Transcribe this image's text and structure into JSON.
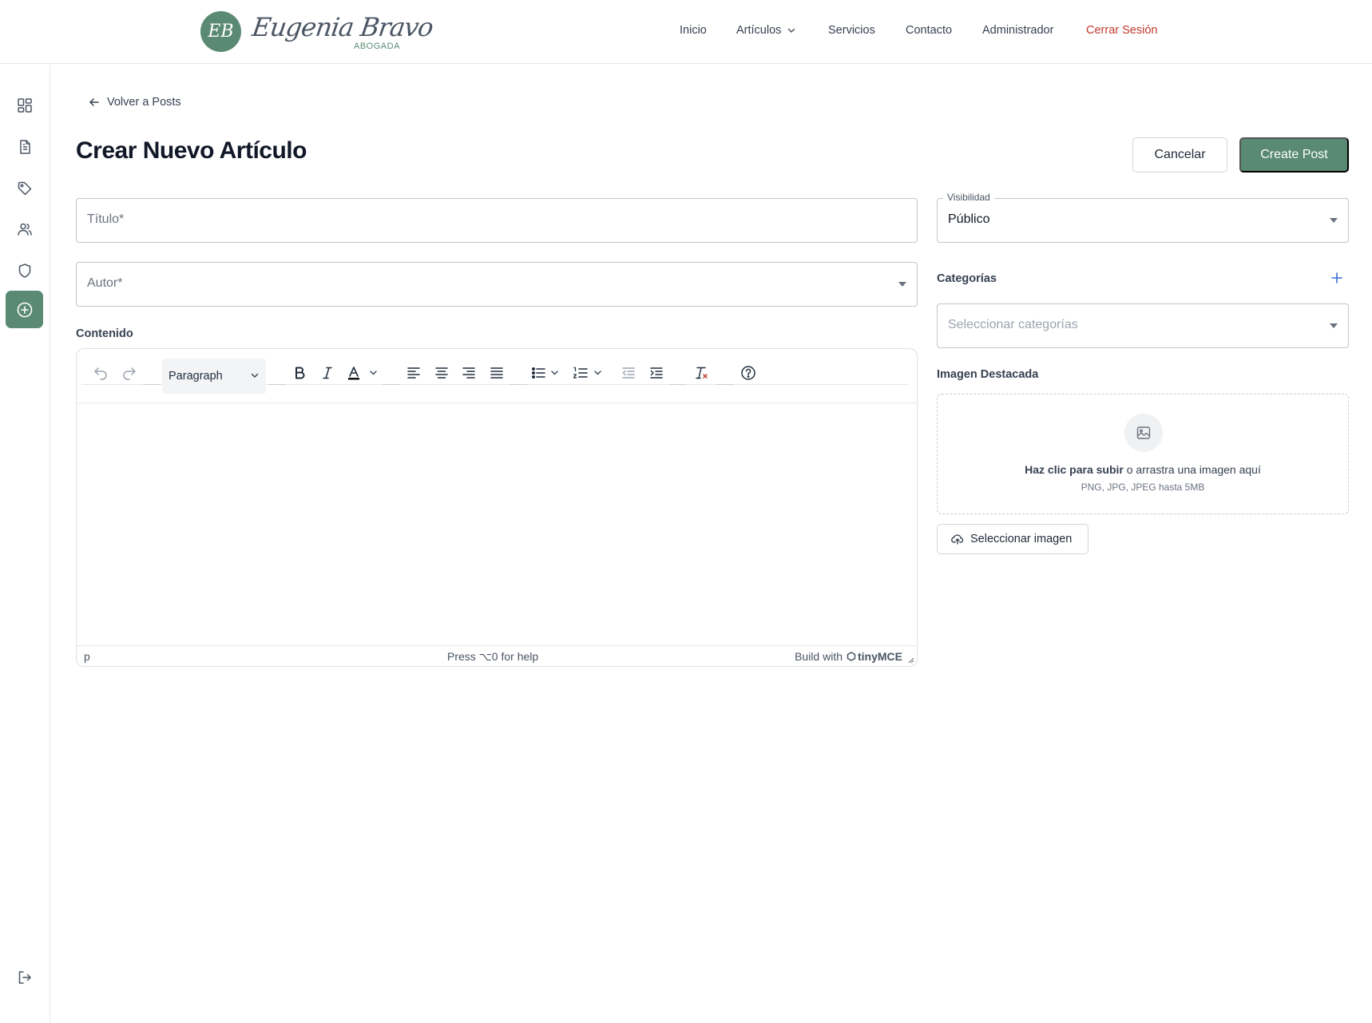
{
  "brand": {
    "monogram": "EB",
    "name": "Eugenia Bravo",
    "subtitle": "ABOGADA",
    "accent": "#5a8a73"
  },
  "nav": {
    "items": [
      {
        "label": "Inicio"
      },
      {
        "label": "Artículos",
        "has_dropdown": true
      },
      {
        "label": "Servicios"
      },
      {
        "label": "Contacto"
      },
      {
        "label": "Administrador"
      },
      {
        "label": "Cerrar Sesión",
        "color": "#c0392b"
      }
    ]
  },
  "sidebar": {
    "items": [
      {
        "icon": "dashboard-icon"
      },
      {
        "icon": "document-icon"
      },
      {
        "icon": "tag-icon"
      },
      {
        "icon": "users-icon"
      },
      {
        "icon": "shield-icon"
      },
      {
        "icon": "plus-circle-icon",
        "active": true
      }
    ],
    "bottom_icon": "logout-icon"
  },
  "page": {
    "back_label": "Volver a Posts",
    "title": "Crear Nuevo Artículo",
    "cancel_label": "Cancelar",
    "create_label": "Create Post"
  },
  "form": {
    "title_label": "Título",
    "title_value": "",
    "author_label": "Autor",
    "author_value": "",
    "required_mark": "*",
    "content_label": "Contenido"
  },
  "editor": {
    "block_format": "Paragraph",
    "content": "",
    "status_path": "p",
    "status_help": "Press ⌥0 for help",
    "status_brand_prefix": "Build with",
    "status_brand_name": "tinyMCE",
    "toolbar_icons": [
      "undo-icon",
      "redo-icon",
      "bold-icon",
      "italic-icon",
      "text-color-icon",
      "align-left-icon",
      "align-center-icon",
      "align-right-icon",
      "align-justify-icon",
      "bullet-list-icon",
      "numbered-list-icon",
      "outdent-icon",
      "indent-icon",
      "clear-format-icon",
      "help-icon"
    ]
  },
  "sidebar_form": {
    "visibility_label": "Visibilidad",
    "visibility_value": "Público",
    "categories_label": "Categorías",
    "categories_placeholder": "Seleccionar categorías",
    "image_label": "Imagen Destacada",
    "upload_strong": "Haz clic para subir",
    "upload_rest": " o arrastra una imagen aquí",
    "upload_hint": "PNG, JPG, JPEG hasta 5MB",
    "select_image_label": "Seleccionar imagen"
  }
}
